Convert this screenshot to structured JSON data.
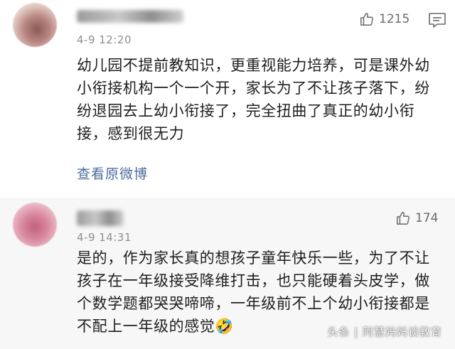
{
  "comments": [
    {
      "time": "4-9 12:20",
      "likes": "1215",
      "text": "幼儿园不提前教知识，更重视能力培养，可是课外幼小衔接机构一个一个开，家长为了不让孩子落下，纷纷退园去上幼小衔接了，完全扭曲了真正的幼小衔接，感到很无力",
      "view_original": "查看原微博"
    },
    {
      "time": "4-9 14:31",
      "likes": "174",
      "text": "是的，作为家长真的想孩子童年快乐一些，为了不让孩子在一年级接受降维打击，也只能硬着头皮学，做个数学题都哭哭啼啼，一年级前不上个幼小衔接都是不配上一年级的感觉🤣"
    }
  ],
  "watermark": "头条 | 阿慧妈妈谈教育",
  "icons": {
    "like": "thumbs-up-icon",
    "comment": "comment-icon"
  },
  "colors": {
    "link": "#4b6c9c",
    "meta": "#8e8e8e",
    "second_bg": "#f7f7f7"
  }
}
